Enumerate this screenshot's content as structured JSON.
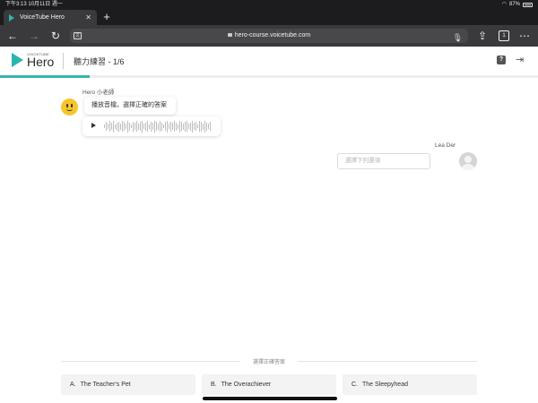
{
  "status_bar": {
    "time": "下午3:13",
    "date": "10月11日 週一",
    "battery": "87%"
  },
  "browser": {
    "tab_title": "VoiceTube Hero",
    "url": "hero-course.voicetube.com",
    "tab_count": "1"
  },
  "app": {
    "logo_small": "VOICETUBE",
    "logo_text": "Hero",
    "title": "聽力練習 - 1/6",
    "progress_fraction": 0.1667,
    "accent_color": "#37b3ae"
  },
  "chat": {
    "bot_name": "Hero 小老師",
    "bot_message": "播放音檔，選擇正確的答案",
    "user_name": "Lea Der",
    "input_placeholder": "選擇下列選項"
  },
  "answers": {
    "section_label": "選擇正確答案",
    "options": [
      {
        "letter": "A.",
        "text": "The Teacher's Pet"
      },
      {
        "letter": "B.",
        "text": "The Overachiever"
      },
      {
        "letter": "C.",
        "text": "The Sleepyhead"
      }
    ]
  }
}
